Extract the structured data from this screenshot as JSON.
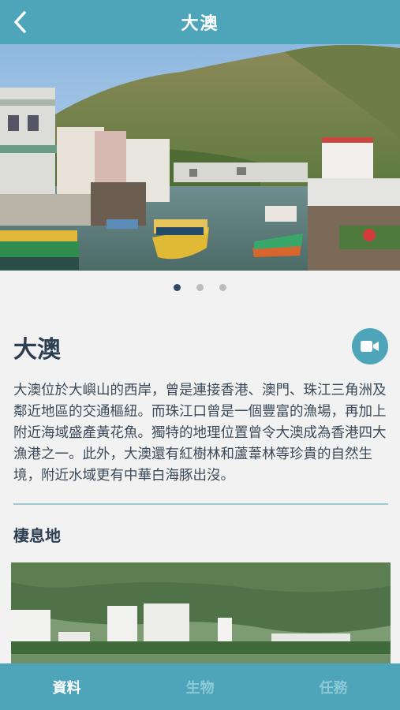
{
  "header": {
    "title": "大澳",
    "back_icon": "chevron-left-icon"
  },
  "carousel": {
    "page_count": 3,
    "active_index": 0
  },
  "content": {
    "title": "大澳",
    "video_icon": "video-camera-icon",
    "description": "大澳位於大嶼山的西岸，曾是連接香港、澳門、珠江三角洲及鄰近地區的交通樞紐。而珠江口曾是一個豐富的漁場，再加上附近海域盛產黃花魚。獨特的地理位置曾令大澳成為香港四大漁港之一。此外，大澳還有紅樹林和蘆葦林等珍貴的自然生境，附近水域更有中華白海豚出沒。",
    "habitat_heading": "棲息地"
  },
  "tabs": [
    {
      "label": "資料",
      "active": true
    },
    {
      "label": "生物",
      "active": false
    },
    {
      "label": "任務",
      "active": false
    }
  ],
  "colors": {
    "accent": "#4ea5b9",
    "heading": "#2c3f52",
    "active_dot": "#2c4a66"
  }
}
